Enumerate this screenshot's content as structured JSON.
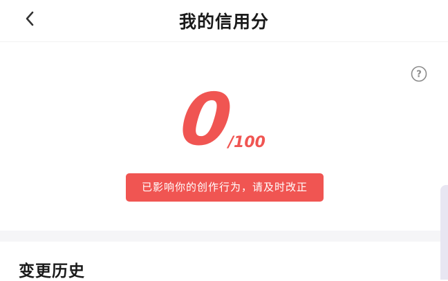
{
  "header": {
    "title": "我的信用分",
    "back_icon": "chevron-left-icon"
  },
  "help": {
    "icon": "question-circle-icon",
    "icon_glyph": "?"
  },
  "score": {
    "value": "0",
    "total": "/100",
    "color": "#f05552"
  },
  "warning": {
    "text": "已影响你的创作行为，请及时改正",
    "background": "#f05552"
  },
  "history": {
    "title": "变更历史"
  }
}
